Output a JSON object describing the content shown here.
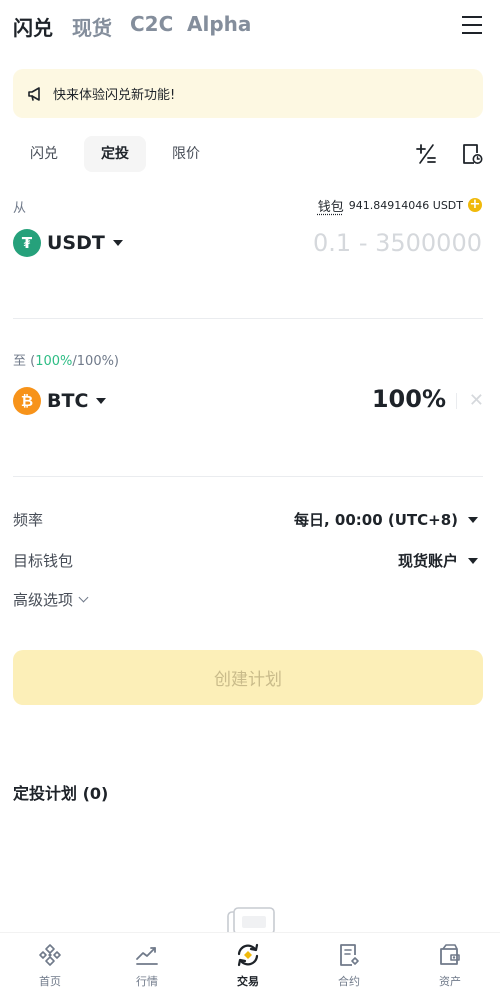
{
  "top_tabs": [
    {
      "label": "闪兑",
      "active": true
    },
    {
      "label": "现货",
      "active": false
    },
    {
      "label": "C2C",
      "active": false
    },
    {
      "label": "Alpha",
      "active": false
    }
  ],
  "banner": {
    "text": "快来体验闪兑新功能!"
  },
  "sub_tabs": [
    {
      "label": "闪兑",
      "active": false
    },
    {
      "label": "定投",
      "active": true
    },
    {
      "label": "限价",
      "active": false
    }
  ],
  "from": {
    "label": "从",
    "wallet_label": "钱包",
    "wallet_balance": "941.84914046 USDT",
    "coin": "USDT",
    "amount_placeholder": "0.1 - 3500000"
  },
  "to": {
    "label_prefix": "至 (",
    "label_pct": "100%",
    "label_suffix": "/100%)",
    "coin": "BTC",
    "percent": "100%"
  },
  "settings": {
    "frequency_label": "频率",
    "frequency_value": "每日, 00:00 (UTC+8)",
    "target_wallet_label": "目标钱包",
    "target_wallet_value": "现货账户",
    "advanced_label": "高级选项"
  },
  "create_button": "创建计划",
  "plans": {
    "title": "定投计划 (0)"
  },
  "bottom_nav": [
    {
      "label": "首页",
      "icon": "home-icon",
      "active": false
    },
    {
      "label": "行情",
      "icon": "markets-icon",
      "active": false
    },
    {
      "label": "交易",
      "icon": "trade-icon",
      "active": true
    },
    {
      "label": "合约",
      "icon": "futures-icon",
      "active": false
    },
    {
      "label": "资产",
      "icon": "assets-icon",
      "active": false
    }
  ],
  "colors": {
    "brand": "#f0b90b",
    "usdt": "#26a17b",
    "btc": "#f7931a",
    "positive": "#2ebd85"
  }
}
